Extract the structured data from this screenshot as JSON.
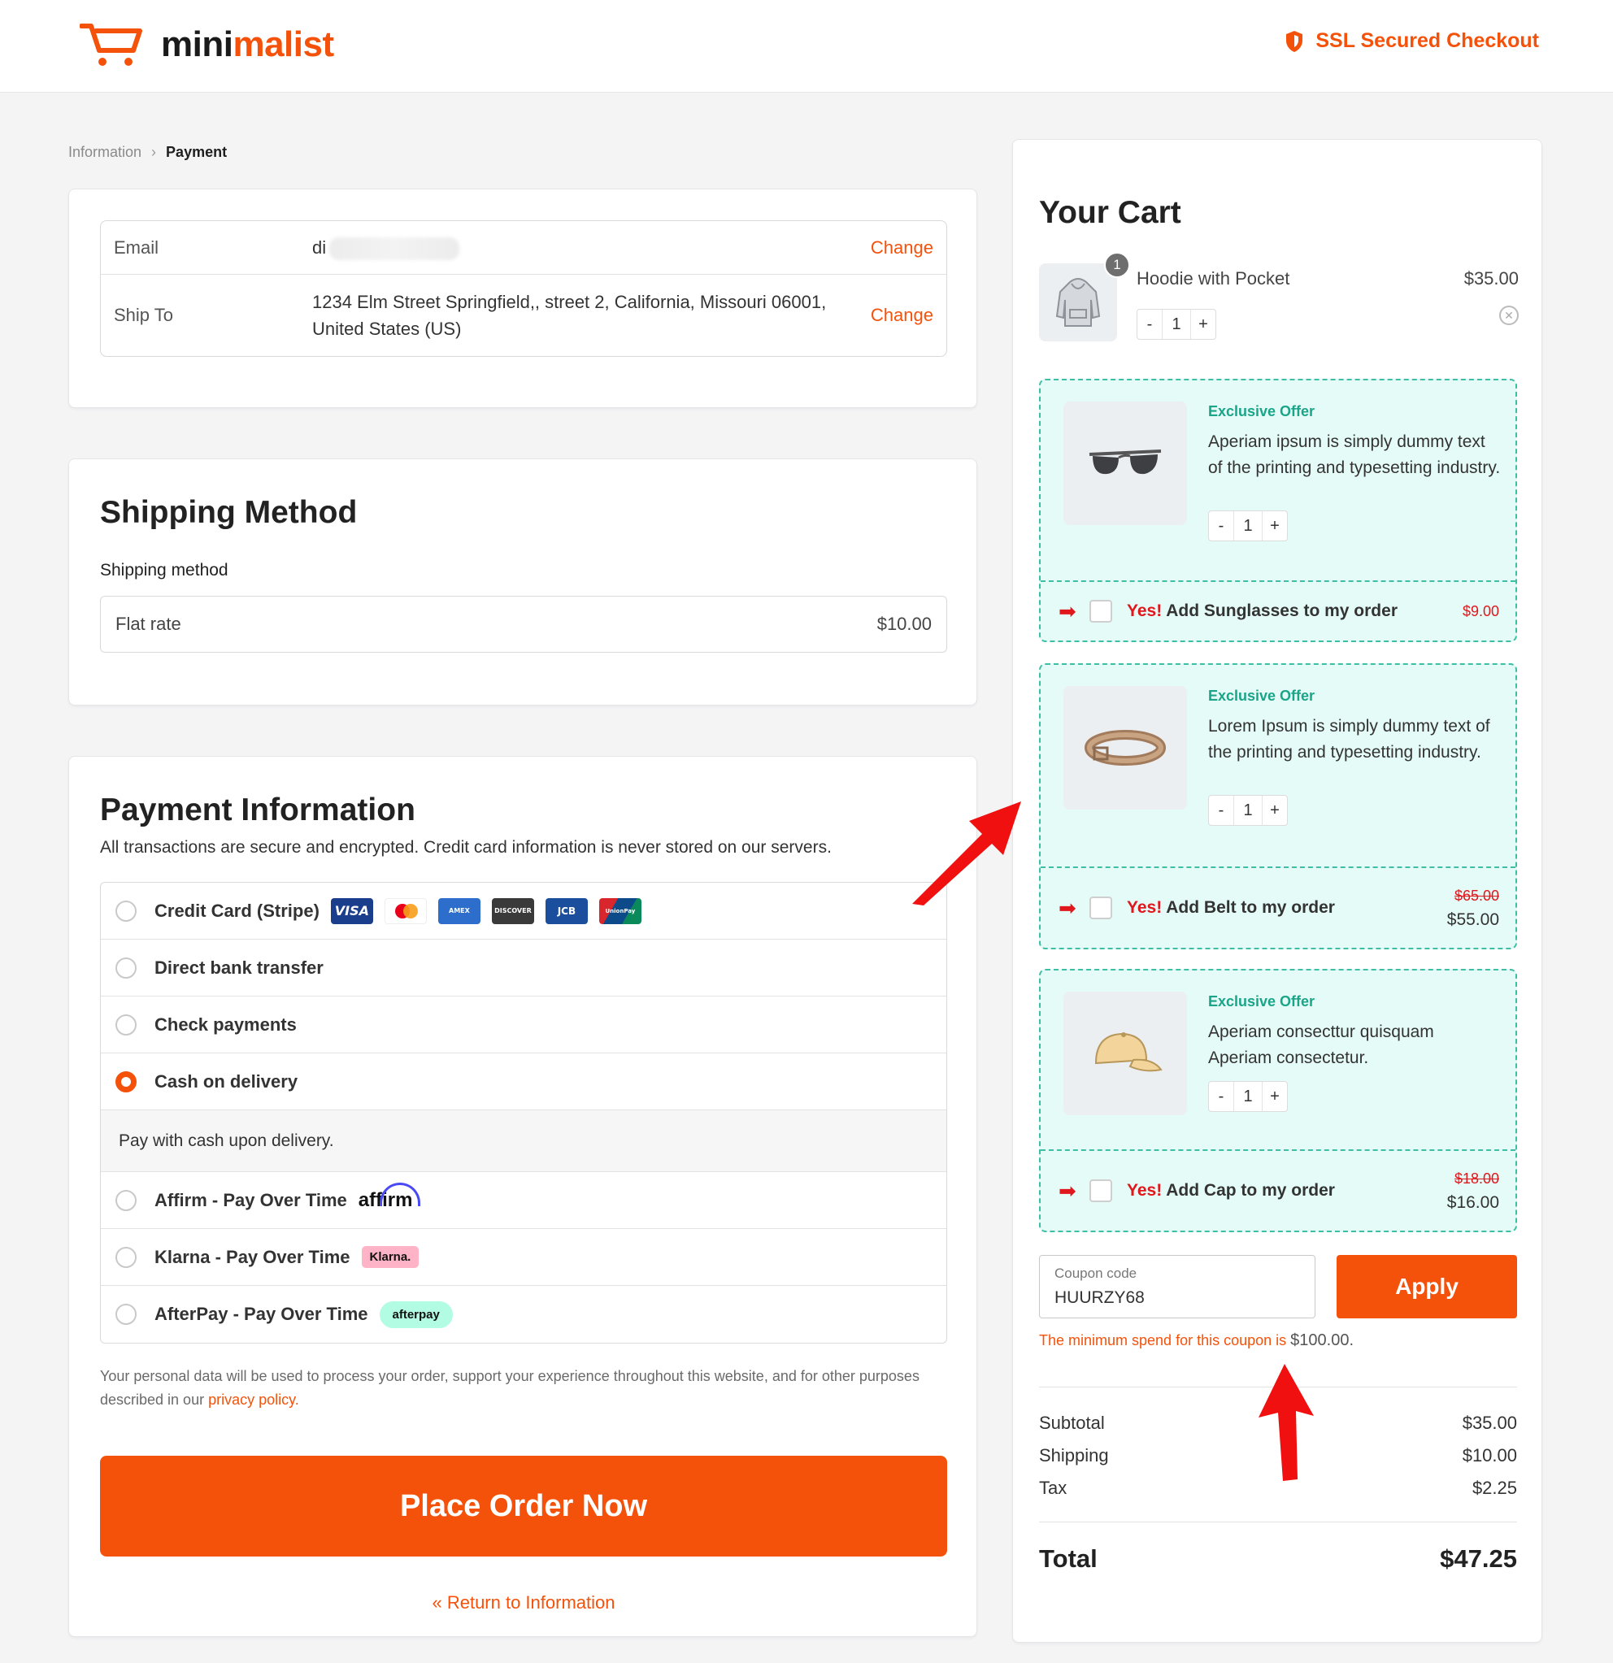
{
  "header": {
    "logo_prefix": "mini",
    "logo_accent": "malist",
    "ssl_label": "SSL Secured Checkout"
  },
  "breadcrumb": {
    "items": [
      "Information",
      "Payment"
    ]
  },
  "contact": {
    "email_label": "Email",
    "email_value": "di",
    "email_change": "Change",
    "ship_label": "Ship To",
    "ship_value": "1234 Elm Street Springfield,, street 2, California, Missouri 06001, United States (US)",
    "ship_change": "Change"
  },
  "shipping": {
    "title": "Shipping Method",
    "label": "Shipping method",
    "method": "Flat rate",
    "price": "$10.00"
  },
  "payment": {
    "title": "Payment Information",
    "subtitle": "All transactions are secure and encrypted. Credit card information is never stored on our servers.",
    "options": [
      {
        "label": "Credit Card (Stripe)",
        "selected": false
      },
      {
        "label": "Direct bank transfer",
        "selected": false
      },
      {
        "label": "Check payments",
        "selected": false
      },
      {
        "label": "Cash on delivery",
        "selected": true
      },
      {
        "label": "Affirm - Pay Over Time",
        "selected": false
      },
      {
        "label": "Klarna - Pay Over Time",
        "selected": false
      },
      {
        "label": "AfterPay - Pay Over Time",
        "selected": false
      }
    ],
    "cod_description": "Pay with cash upon delivery.",
    "card_brands": [
      "VISA",
      "mastercard",
      "AMERICAN EXPRESS",
      "DISCOVER",
      "JCB",
      "UnionPay"
    ],
    "affirm_logo": "affirm",
    "klarna_logo": "Klarna.",
    "afterpay_logo": "afterpay",
    "privacy_text": "Your personal data will be used to process your order, support your experience throughout this website, and for other purposes described in our ",
    "privacy_link": "privacy policy",
    "privacy_end": ".",
    "place_order": "Place Order Now",
    "return_link": "« Return to Information"
  },
  "cart": {
    "title": "Your Cart",
    "item": {
      "name": "Hoodie with Pocket",
      "price": "$35.00",
      "qty": "1",
      "badge": "1"
    },
    "offers": [
      {
        "tag": "Exclusive Offer",
        "description": "Aperiam ipsum is simply dummy text of the printing and typesetting industry.",
        "qty": "1",
        "yes": "Yes!",
        "cta": " Add Sunglasses to my order",
        "price": "$9.00",
        "old_price": ""
      },
      {
        "tag": "Exclusive Offer",
        "description": "Lorem Ipsum is simply dummy text of the printing and typesetting industry.",
        "qty": "1",
        "yes": "Yes!",
        "cta": " Add Belt to my order",
        "price": "$55.00",
        "old_price": "$65.00"
      },
      {
        "tag": "Exclusive Offer",
        "description": "Aperiam consecttur quisquam Aperiam consectetur.",
        "qty": "1",
        "yes": "Yes!",
        "cta": " Add Cap to my order",
        "price": "$16.00",
        "old_price": "$18.00"
      }
    ],
    "coupon": {
      "placeholder": "Coupon code",
      "value": "HUURZY68",
      "apply": "Apply",
      "error": "The minimum spend for this coupon is ",
      "error_amount": "$100.00",
      "error_end": "."
    },
    "summary": {
      "subtotal_label": "Subtotal",
      "subtotal": "$35.00",
      "shipping_label": "Shipping",
      "shipping": "$10.00",
      "tax_label": "Tax",
      "tax": "$2.25",
      "total_label": "Total",
      "total": "$47.25"
    }
  },
  "colors": {
    "accent": "#f4520b",
    "offer_bg": "#e4fbf7",
    "offer_border": "#3ebfa4",
    "yes_red": "#e0181d"
  }
}
